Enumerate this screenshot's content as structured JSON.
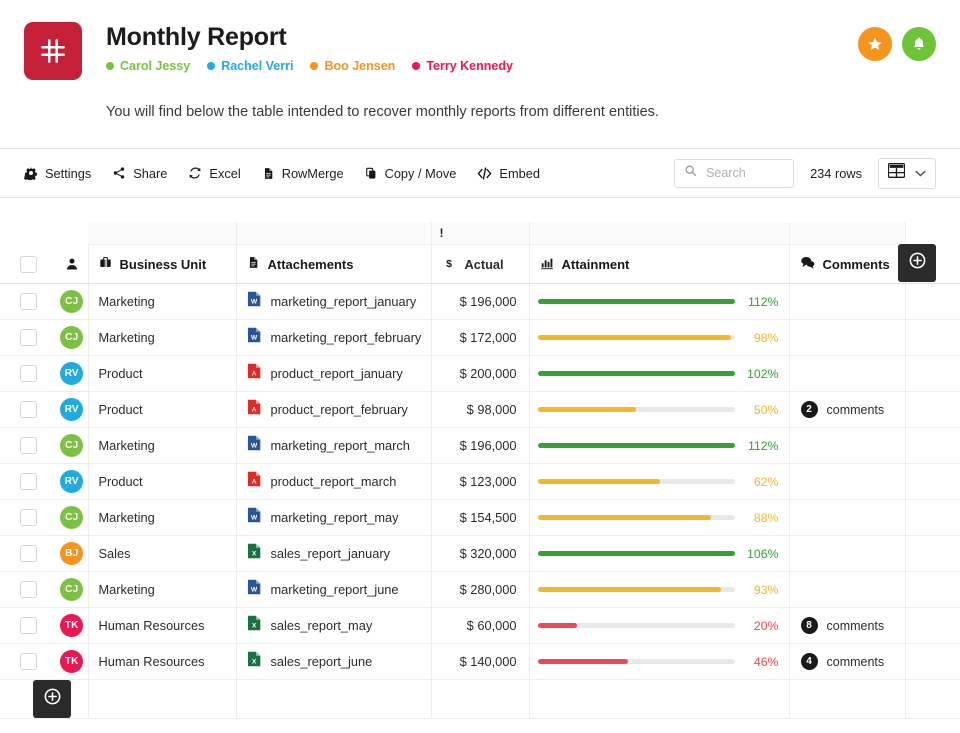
{
  "header": {
    "logo_icon": "hash-icon",
    "logo_color": "#c4203a",
    "title": "Monthly Report",
    "members": [
      {
        "name": "Carol Jessy",
        "color": "#7cc142",
        "initials": "CJ"
      },
      {
        "name": "Rachel Verri",
        "color": "#1fabe2",
        "initials": "RV"
      },
      {
        "name": "Boo Jensen",
        "color": "#f7941e",
        "initials": "BJ"
      },
      {
        "name": "Terry Kennedy",
        "color": "#ed1651",
        "initials": "TK"
      }
    ],
    "actions": [
      {
        "name": "favorite-button",
        "icon": "star-icon",
        "color": "#f7941e"
      },
      {
        "name": "notifications-button",
        "icon": "bell-icon",
        "color": "#6dc437"
      }
    ],
    "intro": "You will find below the table intended to recover monthly reports from different entities."
  },
  "toolbar": {
    "items": [
      {
        "label": "Settings",
        "icon": "gear-icon"
      },
      {
        "label": "Share",
        "icon": "share-icon"
      },
      {
        "label": "Excel",
        "icon": "refresh-icon"
      },
      {
        "label": "RowMerge",
        "icon": "document-icon"
      },
      {
        "label": "Copy / Move",
        "icon": "copy-icon"
      },
      {
        "label": "Embed",
        "icon": "code-icon"
      }
    ],
    "search": {
      "value": "",
      "placeholder": "Search",
      "icon": "search-icon"
    },
    "rows_count": "234 rows",
    "view_selector": {
      "icon": "table-view-icon",
      "caret": "chevron-down-icon"
    }
  },
  "table": {
    "group_band_marker": "!",
    "columns": [
      {
        "key": "check",
        "label": "",
        "icon": "checkbox-icon"
      },
      {
        "key": "avatar",
        "label": "",
        "icon": "person-icon"
      },
      {
        "key": "bu",
        "label": "Business Unit",
        "icon": "briefcase-icon"
      },
      {
        "key": "att",
        "label": "Attachements",
        "icon": "document-icon"
      },
      {
        "key": "actual",
        "label": "Actual",
        "icon": "dollar-icon"
      },
      {
        "key": "attain",
        "label": "Attainment",
        "icon": "bar-chart-icon"
      },
      {
        "key": "comments",
        "label": "Comments",
        "icon": "comments-icon"
      }
    ],
    "add_column_button": {
      "icon": "plus-circle-icon"
    },
    "add_row_button": {
      "icon": "plus-circle-icon"
    },
    "comments_label": "comments",
    "bar_colors": {
      "green": "#34a336",
      "yellow": "#f0b92a",
      "red": "#ec4a5a",
      "track": "#e8e8e8"
    },
    "rows": [
      {
        "checked": false,
        "initials": "CJ",
        "avatar_color": "#7cc142",
        "bu": "Marketing",
        "file": "marketing_report_january",
        "file_type": "word",
        "actual": "$ 196,000",
        "pct": 112,
        "pct_label": "112%",
        "bar": "green",
        "comments": null
      },
      {
        "checked": false,
        "initials": "CJ",
        "avatar_color": "#7cc142",
        "bu": "Marketing",
        "file": "marketing_report_february",
        "file_type": "word",
        "actual": "$ 172,000",
        "pct": 98,
        "pct_label": "98%",
        "bar": "yellow",
        "comments": null
      },
      {
        "checked": false,
        "initials": "RV",
        "avatar_color": "#1fabe2",
        "bu": "Product",
        "file": "product_report_january",
        "file_type": "pdf",
        "actual": "$ 200,000",
        "pct": 102,
        "pct_label": "102%",
        "bar": "green",
        "comments": null
      },
      {
        "checked": false,
        "initials": "RV",
        "avatar_color": "#1fabe2",
        "bu": "Product",
        "file": "product_report_february",
        "file_type": "pdf",
        "actual": "$ 98,000",
        "pct": 50,
        "pct_label": "50%",
        "bar": "yellow",
        "comments": "2"
      },
      {
        "checked": false,
        "initials": "CJ",
        "avatar_color": "#7cc142",
        "bu": "Marketing",
        "file": "marketing_report_march",
        "file_type": "word",
        "actual": "$ 196,000",
        "pct": 112,
        "pct_label": "112%",
        "bar": "green",
        "comments": null
      },
      {
        "checked": false,
        "initials": "RV",
        "avatar_color": "#1fabe2",
        "bu": "Product",
        "file": "product_report_march",
        "file_type": "pdf",
        "actual": "$ 123,000",
        "pct": 62,
        "pct_label": "62%",
        "bar": "yellow",
        "comments": null
      },
      {
        "checked": false,
        "initials": "CJ",
        "avatar_color": "#7cc142",
        "bu": "Marketing",
        "file": "marketing_report_may",
        "file_type": "word",
        "actual": "$ 154,500",
        "pct": 88,
        "pct_label": "88%",
        "bar": "yellow",
        "comments": null
      },
      {
        "checked": false,
        "initials": "BJ",
        "avatar_color": "#f7941e",
        "bu": "Sales",
        "file": "sales_report_january",
        "file_type": "excel",
        "actual": "$ 320,000",
        "pct": 106,
        "pct_label": "106%",
        "bar": "green",
        "comments": null
      },
      {
        "checked": false,
        "initials": "CJ",
        "avatar_color": "#7cc142",
        "bu": "Marketing",
        "file": "marketing_report_june",
        "file_type": "word",
        "actual": "$ 280,000",
        "pct": 93,
        "pct_label": "93%",
        "bar": "yellow",
        "comments": null
      },
      {
        "checked": false,
        "initials": "TK",
        "avatar_color": "#ed1651",
        "bu": "Human Resources",
        "file": "sales_report_may",
        "file_type": "excel",
        "actual": "$ 60,000",
        "pct": 20,
        "pct_label": "20%",
        "bar": "red",
        "comments": "8"
      },
      {
        "checked": false,
        "initials": "TK",
        "avatar_color": "#ed1651",
        "bu": "Human Resources",
        "file": "sales_report_june",
        "file_type": "excel",
        "actual": "$ 140,000",
        "pct": 46,
        "pct_label": "46%",
        "bar": "red",
        "comments": "4"
      }
    ]
  }
}
